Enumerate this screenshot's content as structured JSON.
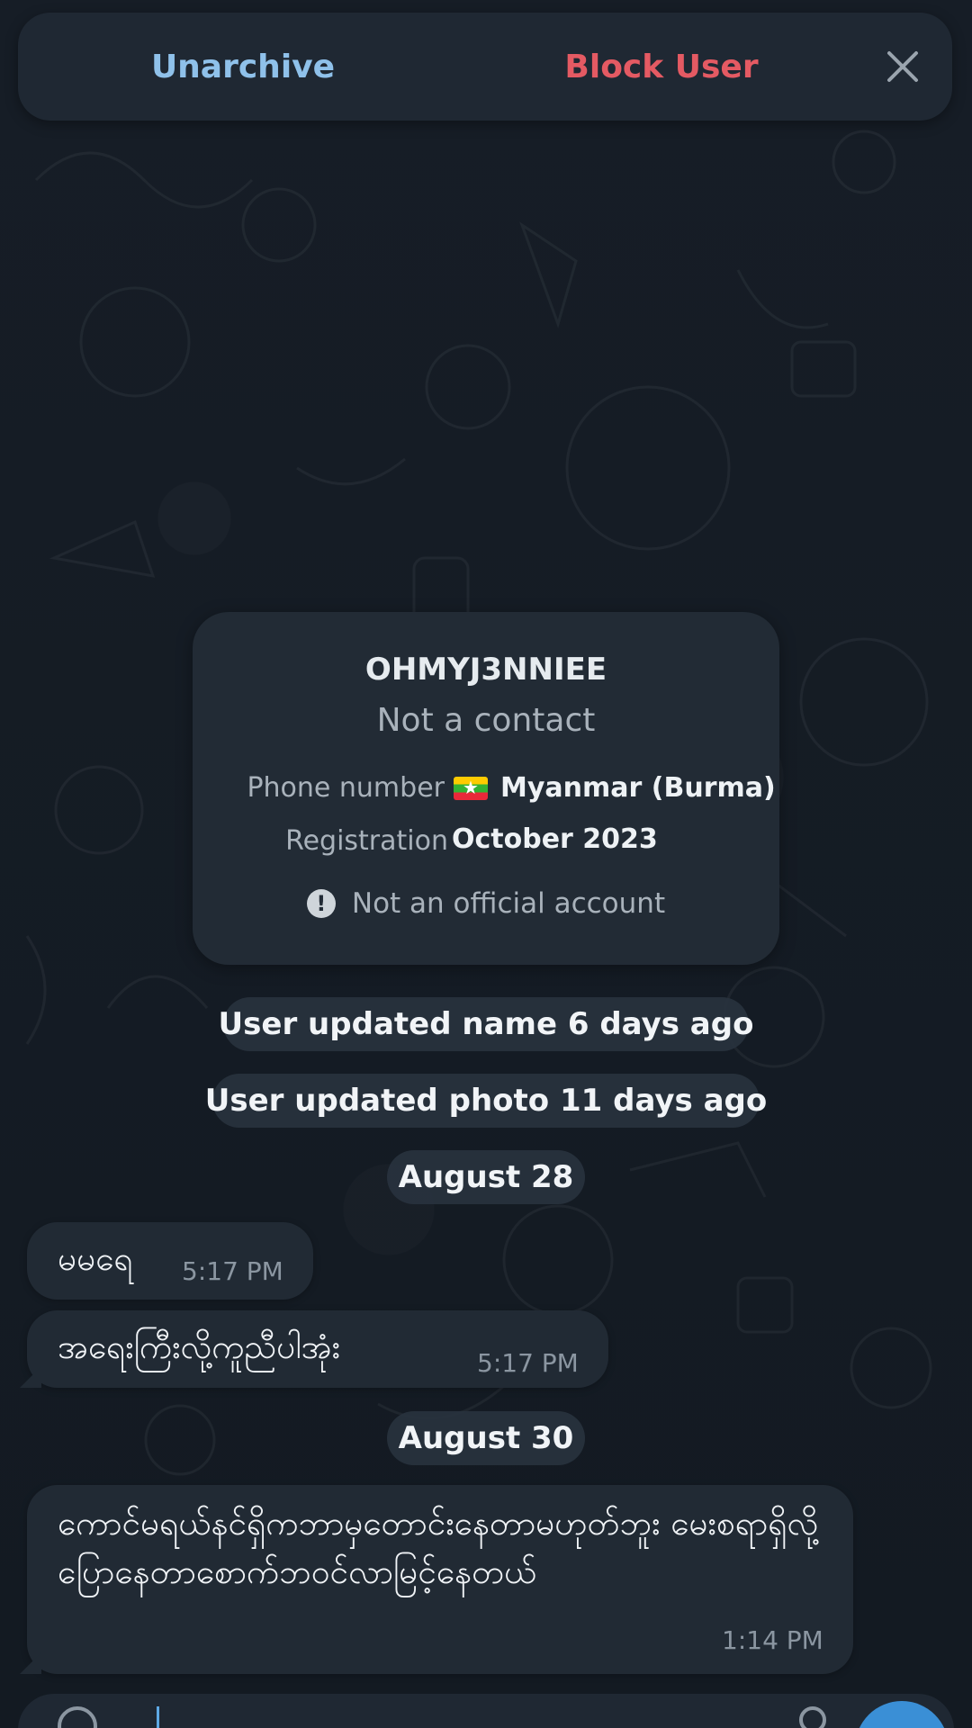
{
  "action_bar": {
    "unarchive_label": "Unarchive",
    "block_label": "Block User"
  },
  "info_card": {
    "name": "OHMYJ3NNIEE",
    "subtitle": "Not a contact",
    "phone_label": "Phone number",
    "phone_country": "Myanmar (Burma)",
    "registration_label": "Registration",
    "registration_value": "October 2023",
    "official_notice": "Not an official account"
  },
  "service": {
    "name_update": "User updated name 6 days ago",
    "photo_update": "User updated photo 11 days ago",
    "date1": "August 28",
    "date2": "August 30"
  },
  "messages": [
    {
      "text": "မမရေ",
      "time": "5:17 PM"
    },
    {
      "text": "အရေးကြီးလို့ကူညီပါအုံး",
      "time": "5:17 PM"
    },
    {
      "text": "ကောင်မရယ်နင်ရှိကဘာမှတောင်းနေတာမဟုတ်ဘူး မေးစရာရှိလို့ပြောနေတာစောက်ဘဝင်လာမြင့်နေတယ်",
      "time": "1:14 PM"
    }
  ],
  "colors": {
    "unarchive": "#8fc1ea",
    "block": "#e45a63",
    "background": "#141b23",
    "bubble": "#212a34",
    "accent": "#3a8fd6"
  },
  "icons": {
    "close": "close-icon",
    "warning": "exclamation-circle-icon",
    "flag": "myanmar-flag-icon",
    "emoji": "emoji-icon",
    "attach": "attach-icon"
  }
}
